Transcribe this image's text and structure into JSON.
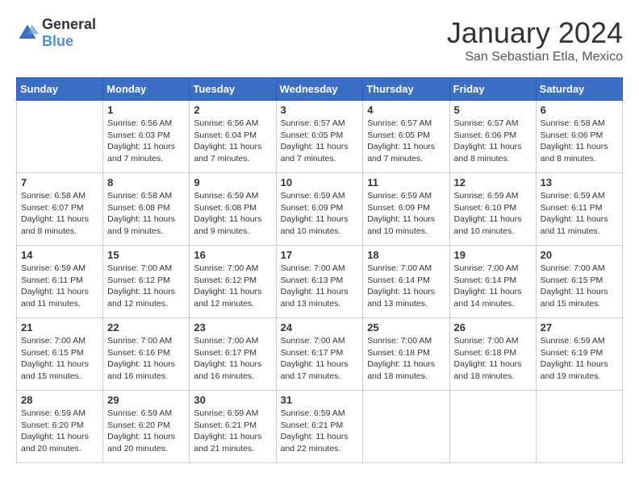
{
  "logo": {
    "general": "General",
    "blue": "Blue"
  },
  "title": "January 2024",
  "subtitle": "San Sebastian Etla, Mexico",
  "days_of_week": [
    "Sunday",
    "Monday",
    "Tuesday",
    "Wednesday",
    "Thursday",
    "Friday",
    "Saturday"
  ],
  "weeks": [
    [
      {
        "day": "",
        "sunrise": "",
        "sunset": "",
        "daylight": ""
      },
      {
        "day": "1",
        "sunrise": "Sunrise: 6:56 AM",
        "sunset": "Sunset: 6:03 PM",
        "daylight": "Daylight: 11 hours and 7 minutes."
      },
      {
        "day": "2",
        "sunrise": "Sunrise: 6:56 AM",
        "sunset": "Sunset: 6:04 PM",
        "daylight": "Daylight: 11 hours and 7 minutes."
      },
      {
        "day": "3",
        "sunrise": "Sunrise: 6:57 AM",
        "sunset": "Sunset: 6:05 PM",
        "daylight": "Daylight: 11 hours and 7 minutes."
      },
      {
        "day": "4",
        "sunrise": "Sunrise: 6:57 AM",
        "sunset": "Sunset: 6:05 PM",
        "daylight": "Daylight: 11 hours and 7 minutes."
      },
      {
        "day": "5",
        "sunrise": "Sunrise: 6:57 AM",
        "sunset": "Sunset: 6:06 PM",
        "daylight": "Daylight: 11 hours and 8 minutes."
      },
      {
        "day": "6",
        "sunrise": "Sunrise: 6:58 AM",
        "sunset": "Sunset: 6:06 PM",
        "daylight": "Daylight: 11 hours and 8 minutes."
      }
    ],
    [
      {
        "day": "7",
        "sunrise": "Sunrise: 6:58 AM",
        "sunset": "Sunset: 6:07 PM",
        "daylight": "Daylight: 11 hours and 8 minutes."
      },
      {
        "day": "8",
        "sunrise": "Sunrise: 6:58 AM",
        "sunset": "Sunset: 6:08 PM",
        "daylight": "Daylight: 11 hours and 9 minutes."
      },
      {
        "day": "9",
        "sunrise": "Sunrise: 6:59 AM",
        "sunset": "Sunset: 6:08 PM",
        "daylight": "Daylight: 11 hours and 9 minutes."
      },
      {
        "day": "10",
        "sunrise": "Sunrise: 6:59 AM",
        "sunset": "Sunset: 6:09 PM",
        "daylight": "Daylight: 11 hours and 10 minutes."
      },
      {
        "day": "11",
        "sunrise": "Sunrise: 6:59 AM",
        "sunset": "Sunset: 6:09 PM",
        "daylight": "Daylight: 11 hours and 10 minutes."
      },
      {
        "day": "12",
        "sunrise": "Sunrise: 6:59 AM",
        "sunset": "Sunset: 6:10 PM",
        "daylight": "Daylight: 11 hours and 10 minutes."
      },
      {
        "day": "13",
        "sunrise": "Sunrise: 6:59 AM",
        "sunset": "Sunset: 6:11 PM",
        "daylight": "Daylight: 11 hours and 11 minutes."
      }
    ],
    [
      {
        "day": "14",
        "sunrise": "Sunrise: 6:59 AM",
        "sunset": "Sunset: 6:11 PM",
        "daylight": "Daylight: 11 hours and 11 minutes."
      },
      {
        "day": "15",
        "sunrise": "Sunrise: 7:00 AM",
        "sunset": "Sunset: 6:12 PM",
        "daylight": "Daylight: 11 hours and 12 minutes."
      },
      {
        "day": "16",
        "sunrise": "Sunrise: 7:00 AM",
        "sunset": "Sunset: 6:12 PM",
        "daylight": "Daylight: 11 hours and 12 minutes."
      },
      {
        "day": "17",
        "sunrise": "Sunrise: 7:00 AM",
        "sunset": "Sunset: 6:13 PM",
        "daylight": "Daylight: 11 hours and 13 minutes."
      },
      {
        "day": "18",
        "sunrise": "Sunrise: 7:00 AM",
        "sunset": "Sunset: 6:14 PM",
        "daylight": "Daylight: 11 hours and 13 minutes."
      },
      {
        "day": "19",
        "sunrise": "Sunrise: 7:00 AM",
        "sunset": "Sunset: 6:14 PM",
        "daylight": "Daylight: 11 hours and 14 minutes."
      },
      {
        "day": "20",
        "sunrise": "Sunrise: 7:00 AM",
        "sunset": "Sunset: 6:15 PM",
        "daylight": "Daylight: 11 hours and 15 minutes."
      }
    ],
    [
      {
        "day": "21",
        "sunrise": "Sunrise: 7:00 AM",
        "sunset": "Sunset: 6:15 PM",
        "daylight": "Daylight: 11 hours and 15 minutes."
      },
      {
        "day": "22",
        "sunrise": "Sunrise: 7:00 AM",
        "sunset": "Sunset: 6:16 PM",
        "daylight": "Daylight: 11 hours and 16 minutes."
      },
      {
        "day": "23",
        "sunrise": "Sunrise: 7:00 AM",
        "sunset": "Sunset: 6:17 PM",
        "daylight": "Daylight: 11 hours and 16 minutes."
      },
      {
        "day": "24",
        "sunrise": "Sunrise: 7:00 AM",
        "sunset": "Sunset: 6:17 PM",
        "daylight": "Daylight: 11 hours and 17 minutes."
      },
      {
        "day": "25",
        "sunrise": "Sunrise: 7:00 AM",
        "sunset": "Sunset: 6:18 PM",
        "daylight": "Daylight: 11 hours and 18 minutes."
      },
      {
        "day": "26",
        "sunrise": "Sunrise: 7:00 AM",
        "sunset": "Sunset: 6:18 PM",
        "daylight": "Daylight: 11 hours and 18 minutes."
      },
      {
        "day": "27",
        "sunrise": "Sunrise: 6:59 AM",
        "sunset": "Sunset: 6:19 PM",
        "daylight": "Daylight: 11 hours and 19 minutes."
      }
    ],
    [
      {
        "day": "28",
        "sunrise": "Sunrise: 6:59 AM",
        "sunset": "Sunset: 6:20 PM",
        "daylight": "Daylight: 11 hours and 20 minutes."
      },
      {
        "day": "29",
        "sunrise": "Sunrise: 6:59 AM",
        "sunset": "Sunset: 6:20 PM",
        "daylight": "Daylight: 11 hours and 20 minutes."
      },
      {
        "day": "30",
        "sunrise": "Sunrise: 6:59 AM",
        "sunset": "Sunset: 6:21 PM",
        "daylight": "Daylight: 11 hours and 21 minutes."
      },
      {
        "day": "31",
        "sunrise": "Sunrise: 6:59 AM",
        "sunset": "Sunset: 6:21 PM",
        "daylight": "Daylight: 11 hours and 22 minutes."
      },
      {
        "day": "",
        "sunrise": "",
        "sunset": "",
        "daylight": ""
      },
      {
        "day": "",
        "sunrise": "",
        "sunset": "",
        "daylight": ""
      },
      {
        "day": "",
        "sunrise": "",
        "sunset": "",
        "daylight": ""
      }
    ]
  ]
}
